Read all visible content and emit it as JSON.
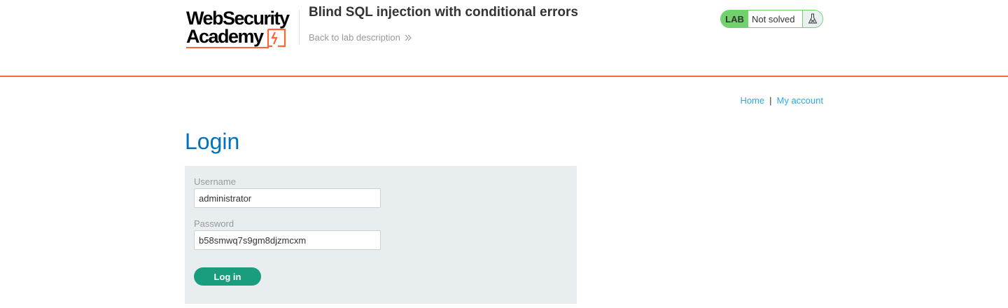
{
  "header": {
    "logo_line1": "WebSecurity",
    "logo_line2": "Academy",
    "lab_title": "Blind SQL injection with conditional errors",
    "back_link": "Back to lab description"
  },
  "status": {
    "badge": "LAB",
    "text": "Not solved",
    "icon": "flask-icon",
    "color": "#70d16d"
  },
  "nav": {
    "home": "Home",
    "separator": "|",
    "account": "My account"
  },
  "page": {
    "title": "Login"
  },
  "form": {
    "username_label": "Username",
    "username_value": "administrator",
    "password_label": "Password",
    "password_value": "b58smwq7s9gm8djzmcxm",
    "submit_label": "Log in"
  },
  "colors": {
    "accent": "#ff6633",
    "title_blue": "#0071bc",
    "link_blue": "#29ace5",
    "button_green": "#1a9c7e"
  }
}
